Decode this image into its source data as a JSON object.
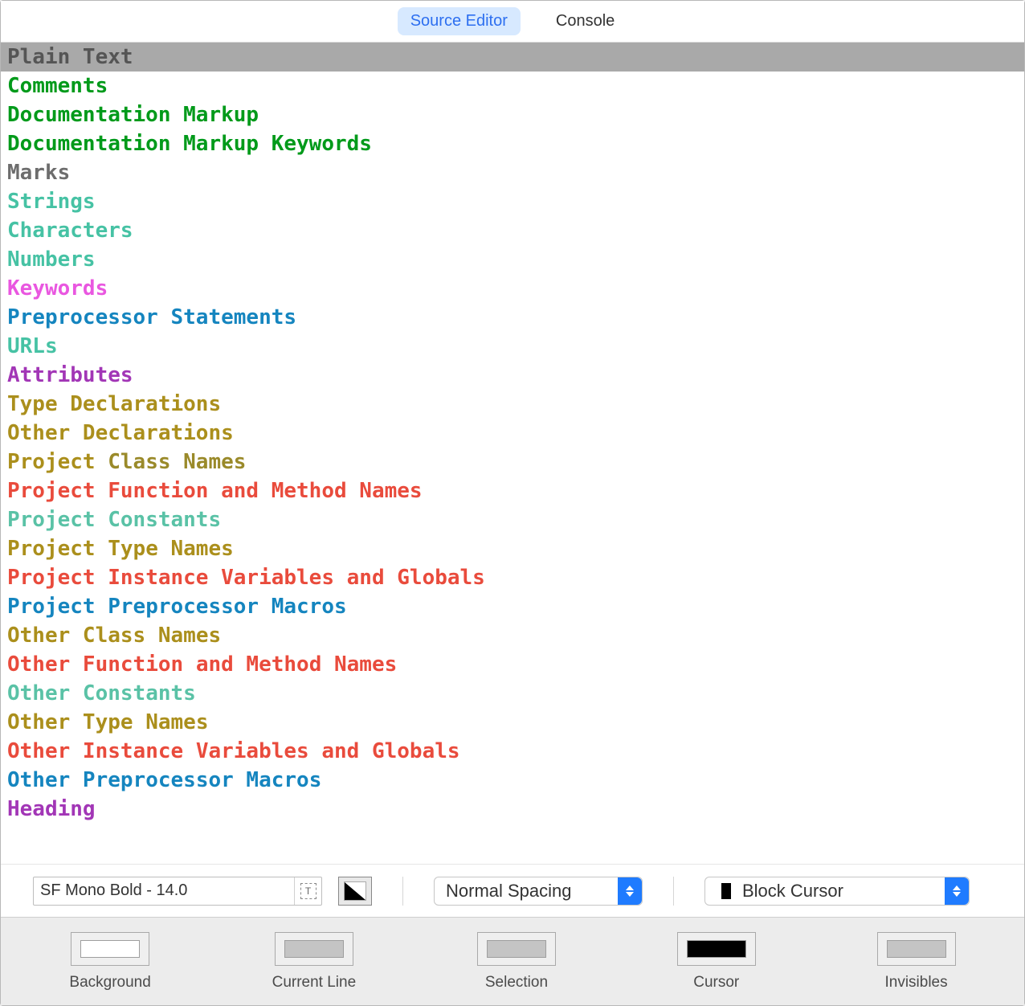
{
  "tabs": {
    "source_editor": "Source Editor",
    "console": "Console"
  },
  "syntax_items": [
    {
      "label": "Plain Text",
      "color": "#555555",
      "selected": true
    },
    {
      "label": "Comments",
      "color": "#009a1a"
    },
    {
      "label": "Documentation Markup",
      "color": "#009a1a"
    },
    {
      "label": "Documentation Markup Keywords",
      "color": "#009a1a"
    },
    {
      "label": "Marks",
      "color": "#6d6d6d"
    },
    {
      "label": "Strings",
      "color": "#46c2a4"
    },
    {
      "label": "Characters",
      "color": "#46c2a4"
    },
    {
      "label": "Numbers",
      "color": "#46c2a4"
    },
    {
      "label": "Keywords",
      "color": "#e957e0"
    },
    {
      "label": "Preprocessor Statements",
      "color": "#1585bf"
    },
    {
      "label": "URLs",
      "color": "#46c2a4"
    },
    {
      "label": "Attributes",
      "color": "#a236b6"
    },
    {
      "label": "Type Declarations",
      "color": "#ab8f1c"
    },
    {
      "label": "Other Declarations",
      "color": "#ab8f1c"
    },
    {
      "parts": [
        {
          "text": "Project",
          "color": "#ab8f1c"
        },
        {
          "text": " Class Names",
          "color": "#9a8a2a"
        }
      ]
    },
    {
      "parts": [
        {
          "text": "Project",
          "color": "#e94b3c"
        },
        {
          "text": " Function and Method Names",
          "color": "#e94b3c"
        }
      ]
    },
    {
      "parts": [
        {
          "text": "Project",
          "color": "#5ac2a6"
        },
        {
          "text": " Constants",
          "color": "#5ac2a6"
        }
      ]
    },
    {
      "parts": [
        {
          "text": "Project",
          "color": "#ab8f1c"
        },
        {
          "text": " Type Names",
          "color": "#ab8f1c"
        }
      ]
    },
    {
      "parts": [
        {
          "text": "Project",
          "color": "#e94b3c"
        },
        {
          "text": " Instance Variables and Globals",
          "color": "#e94b3c"
        }
      ]
    },
    {
      "parts": [
        {
          "text": "Project",
          "color": "#1585bf"
        },
        {
          "text": " Preprocessor Macros",
          "color": "#1585bf"
        }
      ]
    },
    {
      "parts": [
        {
          "text": "Other",
          "color": "#ab8f1c"
        },
        {
          "text": " Class Names",
          "color": "#ab8f1c"
        }
      ]
    },
    {
      "parts": [
        {
          "text": "Other",
          "color": "#e94b3c"
        },
        {
          "text": " Function and Method Names",
          "color": "#e94b3c"
        }
      ]
    },
    {
      "parts": [
        {
          "text": "Other",
          "color": "#5ac2a6"
        },
        {
          "text": " Constants",
          "color": "#5ac2a6"
        }
      ]
    },
    {
      "parts": [
        {
          "text": "Other",
          "color": "#ab8f1c"
        },
        {
          "text": " Type Names",
          "color": "#ab8f1c"
        }
      ]
    },
    {
      "parts": [
        {
          "text": "Other",
          "color": "#e94b3c"
        },
        {
          "text": " Instance Variables and Globals",
          "color": "#e94b3c"
        }
      ]
    },
    {
      "parts": [
        {
          "text": "Other",
          "color": "#1585bf"
        },
        {
          "text": " Preprocessor Macros",
          "color": "#1585bf"
        }
      ]
    },
    {
      "label": "Heading",
      "color": "#a236b6"
    }
  ],
  "controls": {
    "font_value": "SF Mono Bold - 14.0",
    "spacing_label": "Normal Spacing",
    "cursor_label": "Block Cursor"
  },
  "swatches": {
    "background": {
      "label": "Background",
      "color": "#ffffff"
    },
    "current_line": {
      "label": "Current Line",
      "color": "#c4c4c4"
    },
    "selection": {
      "label": "Selection",
      "color": "#c4c4c4"
    },
    "cursor": {
      "label": "Cursor",
      "color": "#000000"
    },
    "invisibles": {
      "label": "Invisibles",
      "color": "#c4c4c4"
    }
  }
}
